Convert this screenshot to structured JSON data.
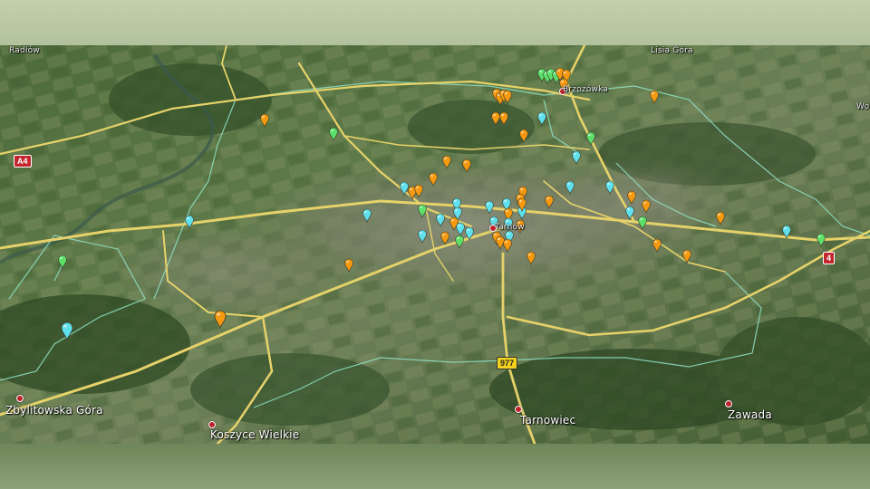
{
  "colors": {
    "marker_orange": "#f59a10",
    "marker_cyan": "#5fe0ec",
    "marker_green": "#5ce06a",
    "road": "#e6d26a",
    "boundary": "#8fe3c8",
    "place_dot": "#c0202a"
  },
  "map": {
    "type": "satellite-view",
    "place_labels": {
      "zbylitowska_gora": "Zbylitowska Góra",
      "koszyce_wielkie": "Koszyce Wielkie",
      "tarnowiec": "Tarnowiec",
      "zawada": "Zawada",
      "brzozowka": "Brzozówka",
      "lisia_gora": "Lisia Góra",
      "tarnow": "Tarnów",
      "radlow": "Radłów",
      "wola": "Wol"
    },
    "road_shields": {
      "r4": "4",
      "r977": "977",
      "r_a4": "A4"
    },
    "marker_legend": [
      "orange",
      "cyan",
      "green"
    ]
  }
}
